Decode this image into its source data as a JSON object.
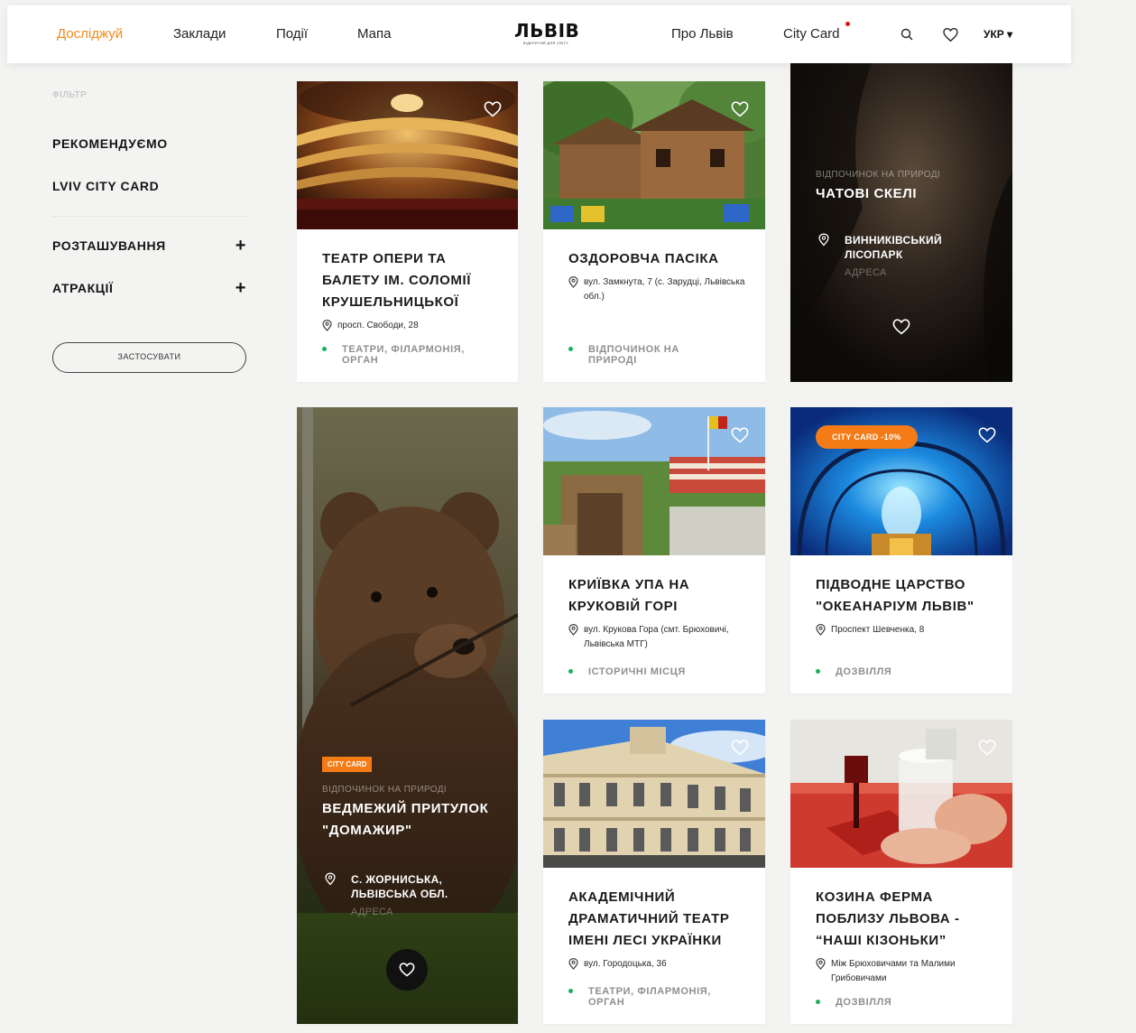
{
  "header": {
    "nav_left": [
      "Досліджуй",
      "Заклади",
      "Події",
      "Мапа"
    ],
    "logo_title": "ЛЬВІВ",
    "logo_sub": "ВІДКРИТИЙ ДЛЯ СВІТУ",
    "nav_right": [
      "Про Львів",
      "City Card"
    ],
    "lang": "УКР ▾",
    "accent_color": "#f08a1c"
  },
  "sidebar": {
    "filter_label": "ФІЛЬТР",
    "items": [
      "РЕКОМЕНДУЄМО",
      "LVIV CITY CARD"
    ],
    "expandable": [
      "РОЗТАШУВАННЯ",
      "АТРАКЦІЇ"
    ],
    "apply_label": "ЗАСТОСУВАТИ"
  },
  "cards": [
    {
      "title": "ТЕАТР ОПЕРИ ТА БАЛЕТУ ІМ. СОЛОМІЇ КРУШЕЛЬНИЦЬКОЇ",
      "address": "просп. Свободи, 28",
      "category": "ТЕАТРИ, ФІЛАРМОНІЯ, ОРГАН"
    },
    {
      "title": "ОЗДОРОВЧА ПАСІКА",
      "address": "вул. Замкнута, 7 (с. Зарудці, Львівська обл.)",
      "category": "ВІДПОЧИНОК НА ПРИРОДІ"
    },
    {
      "category": "ВІДПОЧИНОК НА ПРИРОДІ",
      "title": "ЧАТОВІ СКЕЛІ",
      "location": "ВИННИКІВСЬКИЙ ЛІСОПАРК",
      "location_sub": "АДРЕСА"
    },
    {
      "badge": "CITY CARD",
      "category": "ВІДПОЧИНОК НА ПРИРОДІ",
      "title": "ВЕДМЕЖИЙ ПРИТУЛОК \"ДОМАЖИР\"",
      "location": "С. ЖОРНИСЬКА, ЛЬВІВСЬКА ОБЛ.",
      "location_sub": "АДРЕСА"
    },
    {
      "title": "КРИЇВКА УПА НА КРУКОВІЙ ГОРІ",
      "address": "вул. Крукова Гора (смт. Брюховичі, Львівська МТГ)",
      "category": "ІСТОРИЧНІ МІСЦЯ"
    },
    {
      "badge": "CITY CARD     -10%",
      "title": "ПІДВОДНЕ ЦАРСТВО \"ОКЕАНАРІУМ ЛЬВІВ\"",
      "address": "Проспект Шевченка, 8",
      "category": "ДОЗВІЛЛЯ"
    },
    {
      "title": "АКАДЕМІЧНИЙ ДРАМАТИЧНИЙ ТЕАТР ІМЕНІ ЛЕСІ УКРАЇНКИ",
      "address": "вул. Городоцька, 36",
      "category": "ТЕАТРИ, ФІЛАРМОНІЯ, ОРГАН"
    },
    {
      "title": "КОЗИНА ФЕРМА ПОБЛИЗУ ЛЬВОВА - “НАШІ КІЗОНЬКИ”",
      "address": "Між Брюховичами та Малими Грибовичами",
      "category": "ДОЗВІЛЛЯ"
    }
  ]
}
